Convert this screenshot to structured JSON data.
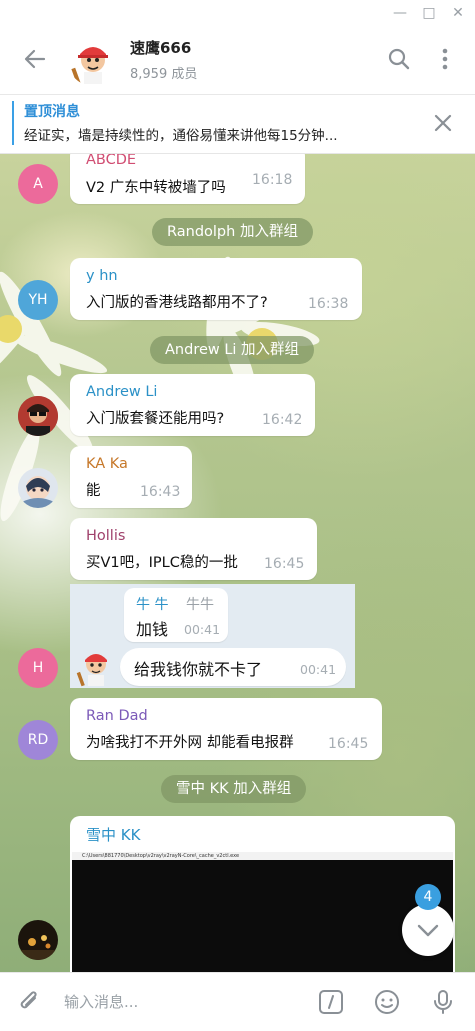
{
  "window": {
    "minimize": "—",
    "maximize": "□",
    "close": "✕"
  },
  "header": {
    "title": "速鹰666",
    "subtitle": "8,959 成员"
  },
  "pinned": {
    "title": "置顶消息",
    "text": "经证实，墙是持续性的，通俗易懂来讲他每15分钟..."
  },
  "messages": [
    {
      "name": "ABCDE",
      "text": "V2 广东中转被墙了吗",
      "time": "16:18",
      "avatar": "A",
      "name_color": "#d14d72",
      "avatar_color": "#ec6a9b"
    },
    {
      "name": "y hn",
      "text": "入门版的香港线路都用不了?",
      "time": "16:38",
      "avatar": "YH",
      "name_color": "#2b91c7",
      "avatar_color": "#4fa6d9"
    },
    {
      "name": "Andrew Li",
      "text": "入门版套餐还能用吗?",
      "time": "16:42",
      "name_color": "#2b91c7"
    },
    {
      "name": "KA Ka",
      "text": "能",
      "time": "16:43",
      "name_color": "#c6782a"
    },
    {
      "name": "Hollis",
      "text": "买V1吧，IPLC稳的一批",
      "time": "16:45",
      "name_color": "#a0426c"
    },
    {
      "name": "Ran Dad",
      "text": "为啥我打不开外网 却能看电报群",
      "time": "16:45",
      "avatar": "RD",
      "name_color": "#7c5ab8",
      "avatar_color": "#9f86d8"
    }
  ],
  "reply": {
    "reply_name": "牛 牛",
    "reply_name2": "牛牛",
    "reply_text": "加钱",
    "reply_time": "00:41",
    "text": "给我钱你就不卡了",
    "time": "00:41",
    "avatar": "H",
    "avatar_color": "#ec6a9b"
  },
  "service": [
    "Randolph 加入群组",
    "Andrew Li 加入群组",
    "雪中 KK 加入群组"
  ],
  "video": {
    "name": "雪中 KK",
    "window_title": "C:\\Users\\881770\\Desktop\\v2ray\\v2rayN-Core\\_cache_v2ctl.exe"
  },
  "unread_count": "4",
  "composer": {
    "placeholder": "输入消息..."
  }
}
